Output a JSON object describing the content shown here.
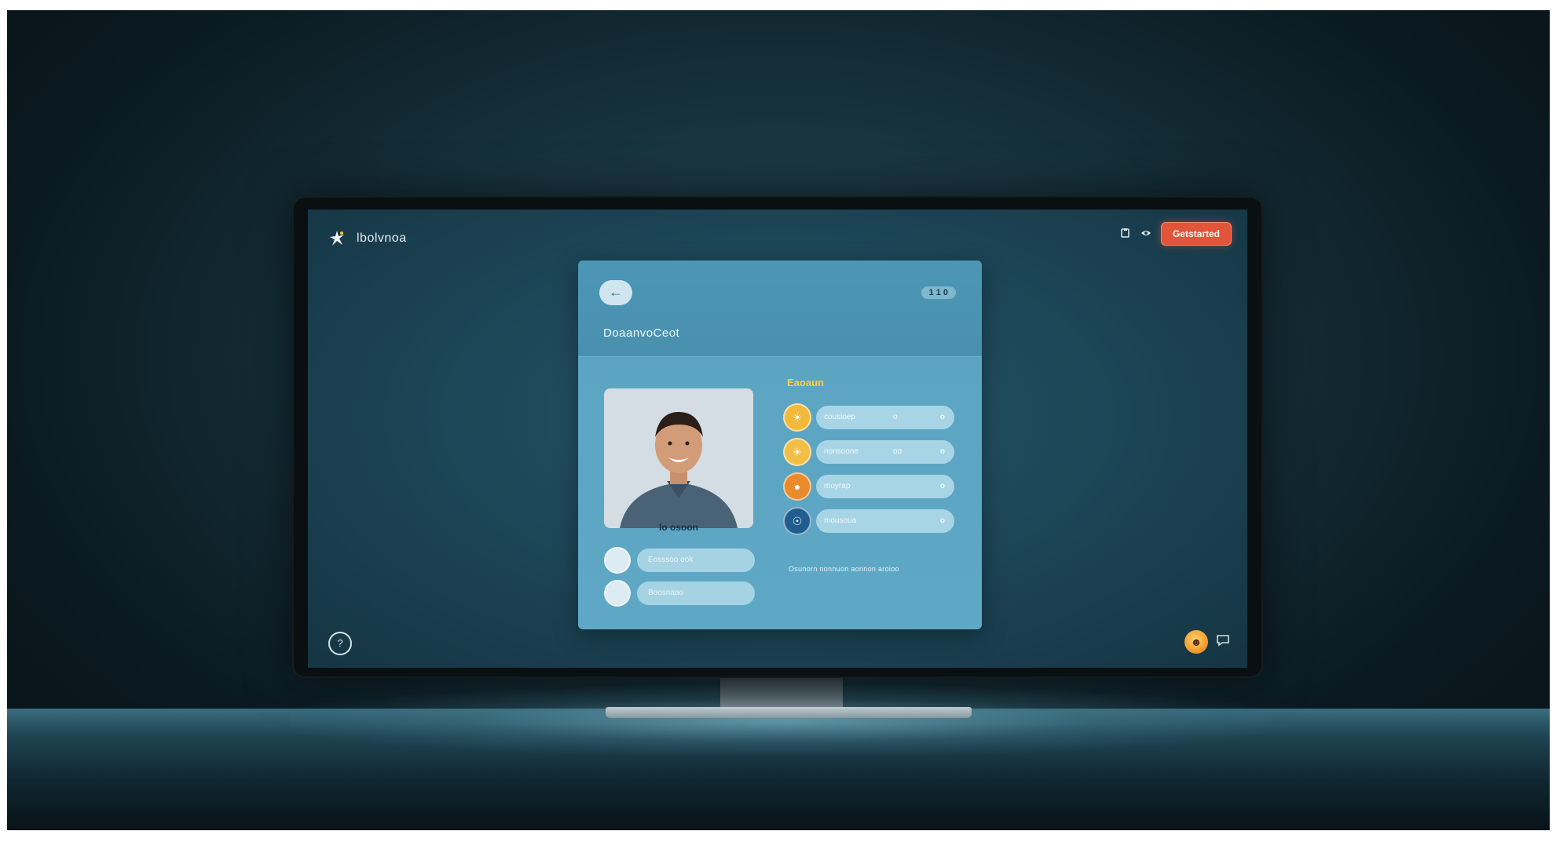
{
  "app": {
    "brand_name": "lbolvnoa",
    "brand_icon": "spark-star-icon"
  },
  "top_right": {
    "icon_1": "paste-icon",
    "icon_2": "eye-icon",
    "cta_label": "Getstarted"
  },
  "card": {
    "back_icon": "back-arrow-icon",
    "header_pill": "1 1 0",
    "title": "DoaanvoCeot",
    "photo_caption": "Io osoon",
    "left_items": [
      {
        "label": "Eosssoo ook"
      },
      {
        "label": "Boosnaao"
      }
    ],
    "section_label": "Eaoaun",
    "options": [
      {
        "label": "cousioep",
        "mid": "o",
        "end": "o",
        "color": "#f2b93a"
      },
      {
        "label": "nonsoone",
        "mid": "oo",
        "end": "o",
        "color": "#f3be45"
      },
      {
        "label": "moyrap",
        "mid": "",
        "end": "o",
        "color": "#e98a2b"
      },
      {
        "label": "mousoua",
        "mid": "",
        "end": "o",
        "color": "#1f5e8e"
      }
    ],
    "footnote": "Osunorn nonnuon aonnon aroioo"
  },
  "bottom": {
    "help_icon": "help-circle-icon",
    "avatar_icon": "user-avatar-icon",
    "chat_icon": "chat-icon"
  }
}
